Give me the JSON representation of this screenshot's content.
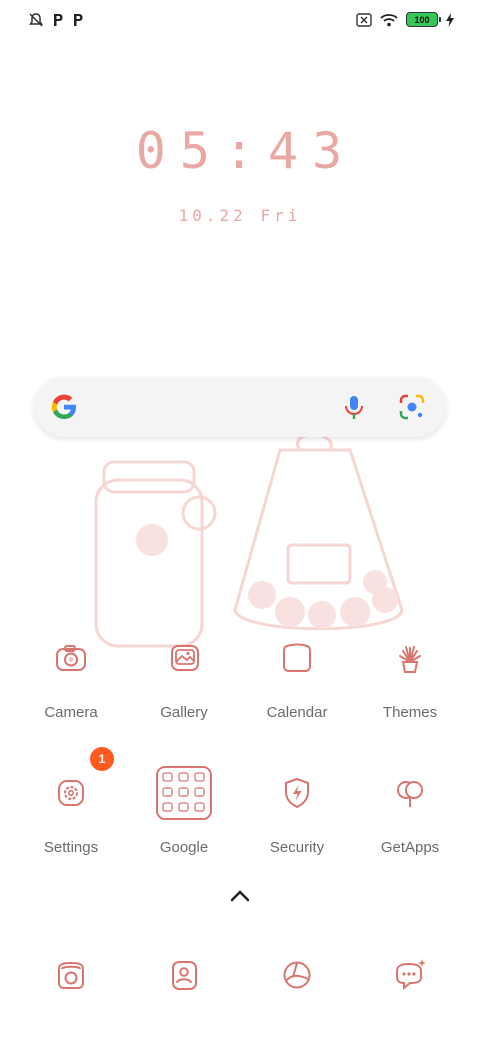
{
  "status_bar": {
    "icons_left": [
      "notifications-off-icon",
      "parking-icon",
      "parking-icon"
    ],
    "icons_right": [
      "sim-off-icon",
      "wifi-icon",
      "battery-icon",
      "charging-icon"
    ],
    "battery_level": "100"
  },
  "lockclock": {
    "time": "05:43",
    "date": "10.22  Fri"
  },
  "search": {
    "icons": [
      "google-g-icon",
      "mic-icon",
      "lens-icon"
    ]
  },
  "apps": [
    {
      "label": "Camera"
    },
    {
      "label": "Gallery"
    },
    {
      "label": "Calendar"
    },
    {
      "label": "Themes"
    },
    {
      "label": "Settings",
      "badge": "1"
    },
    {
      "label": "Google"
    },
    {
      "label": "Security"
    },
    {
      "label": "GetApps"
    }
  ],
  "dock": {
    "icons": [
      "phone-icon",
      "contacts-icon",
      "browser-icon",
      "messages-icon"
    ]
  },
  "colors": {
    "accent": "#d9756f",
    "text_pink": "#e9a8a3",
    "badge": "#ff5a1f"
  }
}
